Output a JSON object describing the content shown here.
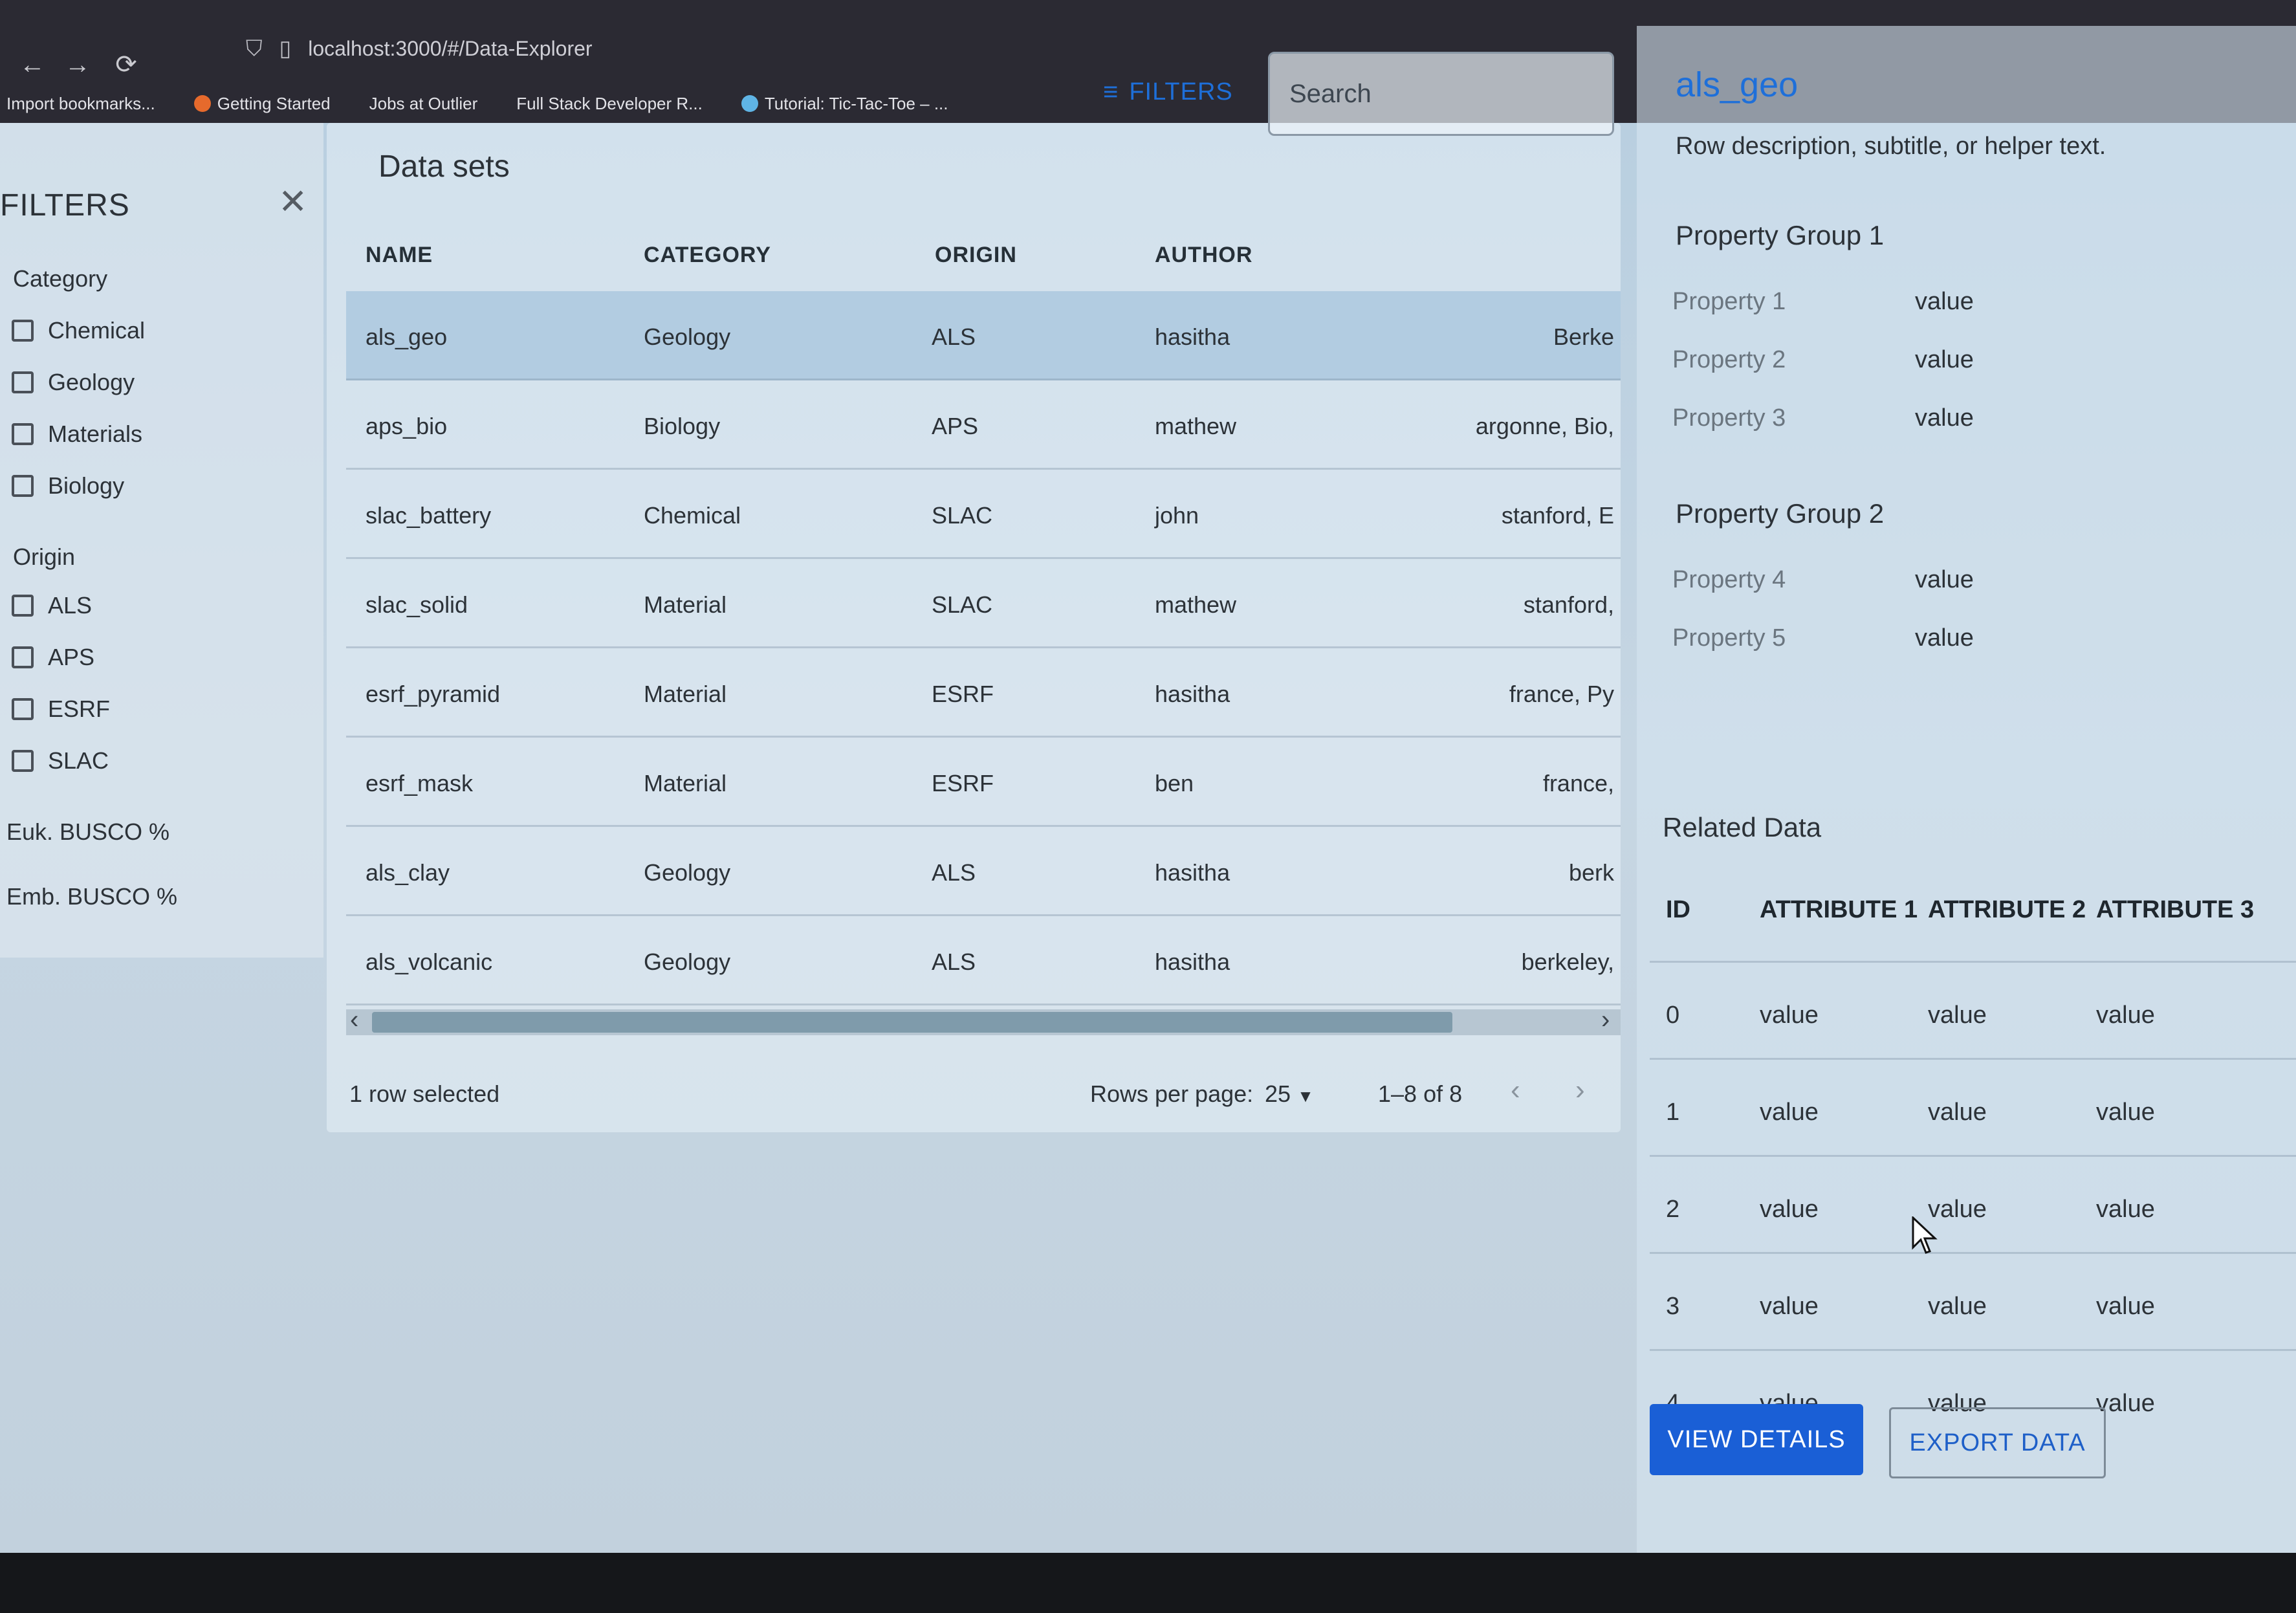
{
  "browser": {
    "url": "localhost:3000/#/Data-Explorer",
    "bookmarks": [
      "Import bookmarks...",
      "Getting Started",
      "Jobs at Outlier",
      "Full Stack Developer R...",
      "Tutorial: Tic-Tac-Toe – ..."
    ]
  },
  "filters": {
    "title": "FILTERS",
    "category_label": "Category",
    "categories": [
      "Chemical",
      "Geology",
      "Materials",
      "Biology"
    ],
    "origin_label": "Origin",
    "origins": [
      "ALS",
      "APS",
      "ESRF",
      "SLAC"
    ],
    "ranges": [
      "Euk. BUSCO %",
      "Emb. BUSCO %"
    ]
  },
  "datasets": {
    "title": "Data sets",
    "filter_button": "FILTERS",
    "search_placeholder": "Search",
    "columns": [
      "NAME",
      "CATEGORY",
      "ORIGIN",
      "AUTHOR"
    ],
    "rows": [
      {
        "name": "als_geo",
        "category": "Geology",
        "origin": "ALS",
        "author": "hasitha",
        "extra": "Berke"
      },
      {
        "name": "aps_bio",
        "category": "Biology",
        "origin": "APS",
        "author": "mathew",
        "extra": "argonne, Bio,"
      },
      {
        "name": "slac_battery",
        "category": "Chemical",
        "origin": "SLAC",
        "author": "john",
        "extra": "stanford, E"
      },
      {
        "name": "slac_solid",
        "category": "Material",
        "origin": "SLAC",
        "author": "mathew",
        "extra": "stanford,"
      },
      {
        "name": "esrf_pyramid",
        "category": "Material",
        "origin": "ESRF",
        "author": "hasitha",
        "extra": "france, Py"
      },
      {
        "name": "esrf_mask",
        "category": "Material",
        "origin": "ESRF",
        "author": "ben",
        "extra": "france,"
      },
      {
        "name": "als_clay",
        "category": "Geology",
        "origin": "ALS",
        "author": "hasitha",
        "extra": "berk"
      },
      {
        "name": "als_volcanic",
        "category": "Geology",
        "origin": "ALS",
        "author": "hasitha",
        "extra": "berkeley,"
      }
    ],
    "selected_text": "1 row selected",
    "rows_per_page_label": "Rows per page:",
    "rows_per_page": "25",
    "range_text": "1–8 of 8"
  },
  "detail": {
    "title": "als_geo",
    "subtitle": "Row description, subtitle, or helper text.",
    "group1_title": "Property Group 1",
    "group1": [
      {
        "label": "Property 1",
        "value": "value"
      },
      {
        "label": "Property 2",
        "value": "value"
      },
      {
        "label": "Property 3",
        "value": "value"
      }
    ],
    "group2_title": "Property Group 2",
    "group2": [
      {
        "label": "Property 4",
        "value": "value"
      },
      {
        "label": "Property 5",
        "value": "value"
      }
    ],
    "related_title": "Related Data",
    "related_columns": [
      "ID",
      "ATTRIBUTE 1",
      "ATTRIBUTE 2",
      "ATTRIBUTE 3"
    ],
    "related_rows": [
      {
        "id": "0",
        "a1": "value",
        "a2": "value",
        "a3": "value"
      },
      {
        "id": "1",
        "a1": "value",
        "a2": "value",
        "a3": "value"
      },
      {
        "id": "2",
        "a1": "value",
        "a2": "value",
        "a3": "value"
      },
      {
        "id": "3",
        "a1": "value",
        "a2": "value",
        "a3": "value"
      },
      {
        "id": "4",
        "a1": "value",
        "a2": "value",
        "a3": "value"
      }
    ],
    "view_details": "VIEW DETAILS",
    "export_data": "EXPORT DATA"
  }
}
